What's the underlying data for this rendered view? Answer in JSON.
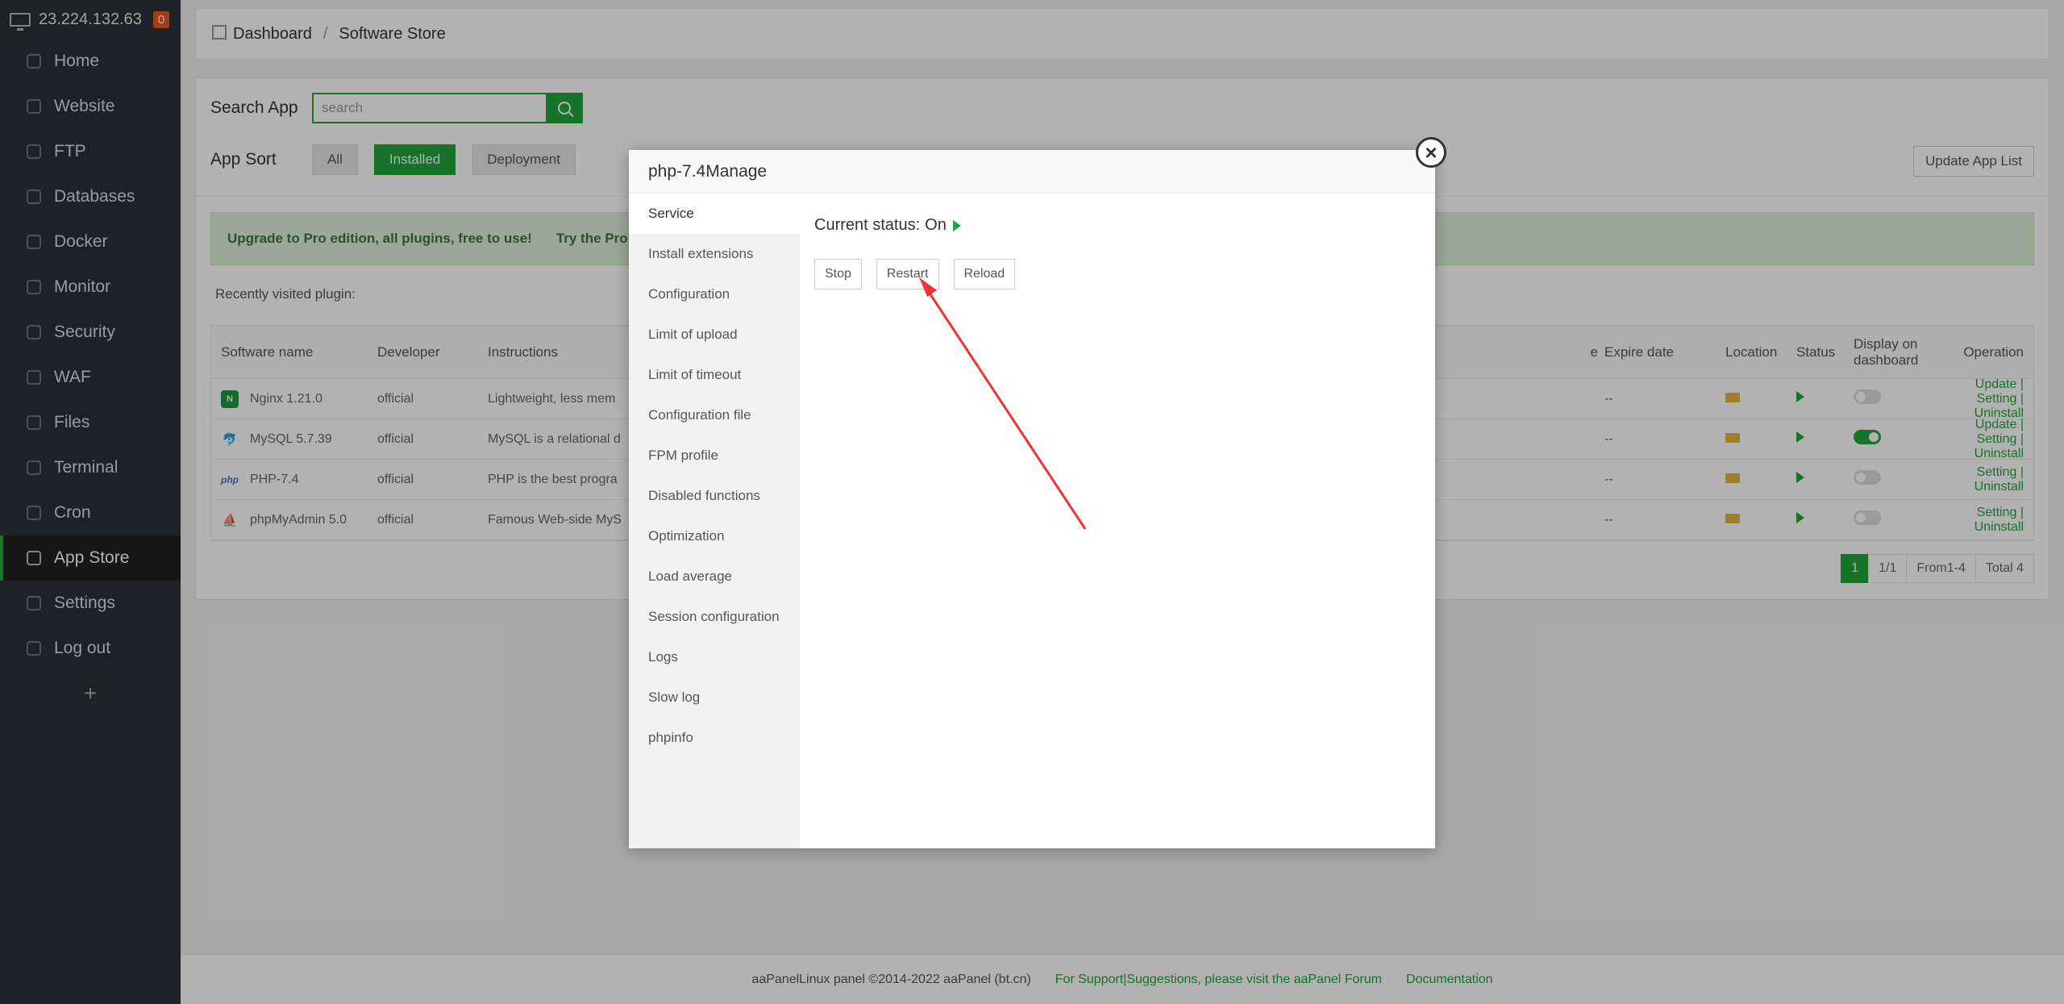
{
  "sidebar": {
    "server_ip": "23.224.132.63",
    "badge": "0",
    "items": [
      {
        "label": "Home",
        "icon": "home-icon"
      },
      {
        "label": "Website",
        "icon": "globe-icon"
      },
      {
        "label": "FTP",
        "icon": "ftp-icon"
      },
      {
        "label": "Databases",
        "icon": "database-icon"
      },
      {
        "label": "Docker",
        "icon": "docker-icon"
      },
      {
        "label": "Monitor",
        "icon": "monitor-icon"
      },
      {
        "label": "Security",
        "icon": "shield-icon"
      },
      {
        "label": "WAF",
        "icon": "waf-icon"
      },
      {
        "label": "Files",
        "icon": "folder-icon"
      },
      {
        "label": "Terminal",
        "icon": "terminal-icon"
      },
      {
        "label": "Cron",
        "icon": "calendar-icon"
      },
      {
        "label": "App Store",
        "icon": "grid-icon"
      },
      {
        "label": "Settings",
        "icon": "gear-icon"
      },
      {
        "label": "Log out",
        "icon": "logout-icon"
      }
    ],
    "add": "+"
  },
  "breadcrumb": {
    "home": "Dashboard",
    "sep": "/",
    "current": "Software Store"
  },
  "search": {
    "label": "Search App",
    "placeholder": "search"
  },
  "sort": {
    "label": "App Sort",
    "options": [
      "All",
      "Installed",
      "Deployment"
    ],
    "selected": "Installed"
  },
  "update_list": "Update App List",
  "promo": {
    "text": "Upgrade to Pro edition, all plugins, free to use!",
    "try": "Try the Pro"
  },
  "recent": "Recently visited plugin:",
  "table": {
    "headers": {
      "name": "Software name",
      "dev": "Developer",
      "ins": "Instructions",
      "price": "e",
      "exp": "Expire date",
      "loc": "Location",
      "status": "Status",
      "disp": "Display on dashboard",
      "op": "Operation"
    },
    "rows": [
      {
        "name": "Nginx 1.21.0",
        "dev": "official",
        "ins": "Lightweight, less mem",
        "exp": "--",
        "op": "Update | Setting | Uninstall",
        "dash": false
      },
      {
        "name": "MySQL 5.7.39",
        "dev": "official",
        "ins": "MySQL is a relational d",
        "exp": "--",
        "op": "Update | Setting | Uninstall",
        "dash": true
      },
      {
        "name": "PHP-7.4",
        "dev": "official",
        "ins": "PHP is the best progra",
        "exp": "--",
        "op": "Setting | Uninstall",
        "dash": false
      },
      {
        "name": "phpMyAdmin 5.0",
        "dev": "official",
        "ins": "Famous Web-side MyS",
        "exp": "--",
        "op": "Setting | Uninstall",
        "dash": false
      }
    ]
  },
  "pager": {
    "current": "1",
    "pages": "1/1",
    "range": "From1-4",
    "total": "Total 4"
  },
  "footer": {
    "copyright": "aaPanelLinux panel ©2014-2022 aaPanel (bt.cn)",
    "support": "For Support|Suggestions, please visit the aaPanel Forum",
    "docs": "Documentation"
  },
  "modal": {
    "title": "php-7.4Manage",
    "close": "×",
    "menu": [
      "Service",
      "Install extensions",
      "Configuration",
      "Limit of upload",
      "Limit of timeout",
      "Configuration file",
      "FPM profile",
      "Disabled functions",
      "Optimization",
      "Load average",
      "Session configuration",
      "Logs",
      "Slow log",
      "phpinfo"
    ],
    "status_label": "Current status:",
    "status_value": "On",
    "buttons": [
      "Stop",
      "Restart",
      "Reload"
    ]
  },
  "colors": {
    "accent": "#20a53a",
    "sidebar": "#2c3138",
    "annotation_arrow": "#ee3333"
  }
}
